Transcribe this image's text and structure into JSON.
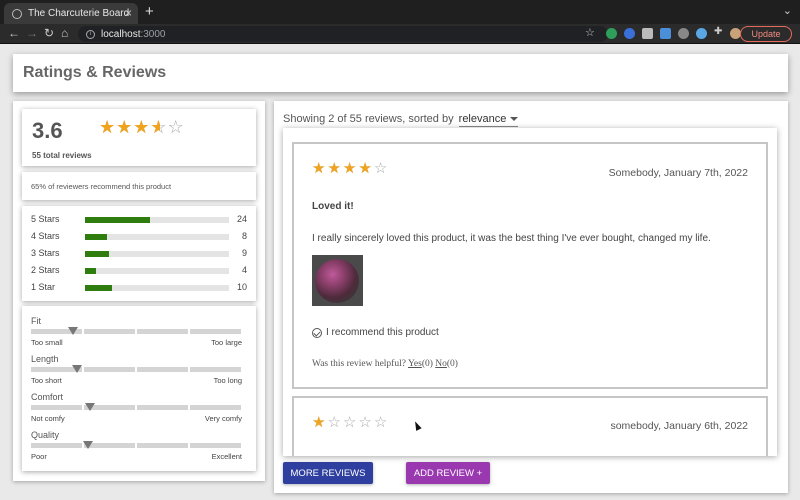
{
  "browser": {
    "tab_title": "The Charcuterie Board",
    "url_host": "localhost",
    "url_port": ":3000",
    "update_label": "Update"
  },
  "page": {
    "title": "Ratings & Reviews"
  },
  "summary": {
    "average": "3.6",
    "average_value": 3.6,
    "total_reviews": "55 total reviews",
    "recommend_text": "65% of reviewers recommend this product"
  },
  "breakdown": [
    {
      "label": "5 Stars",
      "count": "24",
      "value": 24
    },
    {
      "label": "4 Stars",
      "count": "8",
      "value": 8
    },
    {
      "label": "3 Stars",
      "count": "9",
      "value": 9
    },
    {
      "label": "2 Stars",
      "count": "4",
      "value": 4
    },
    {
      "label": "1 Star",
      "count": "10",
      "value": 10
    }
  ],
  "characteristics": [
    {
      "name": "Fit",
      "low": "Too small",
      "high": "Too large",
      "level": 0.2
    },
    {
      "name": "Length",
      "low": "Too short",
      "high": "Too long",
      "level": 0.22
    },
    {
      "name": "Comfort",
      "low": "Not comfy",
      "high": "Very comfy",
      "level": 0.28
    },
    {
      "name": "Quality",
      "low": "Poor",
      "high": "Excellent",
      "level": 0.27
    }
  ],
  "list": {
    "showing_text": "Showing 2 of 55 reviews, sorted by",
    "sort_value": "relevance"
  },
  "reviews": [
    {
      "rating": 4,
      "author_date": "Somebody, January 7th, 2022",
      "summary": "Loved it!",
      "body": "I really sincerely loved this product, it was the best thing I've ever bought, changed my life.",
      "recommend": "I recommend this product",
      "helpful_prefix": "Was this review helpful?",
      "yes_label": "Yes",
      "yes_count": "(0)",
      "no_label": "No",
      "no_count": "(0)"
    },
    {
      "rating": 1,
      "author_date": "somebody, January 6th, 2022"
    }
  ],
  "buttons": {
    "more_reviews": "MORE REVIEWS",
    "add_review": "ADD REVIEW +"
  },
  "colors": {
    "star": "#f0a31f",
    "bar_fill": "#2e7d0e",
    "more_button": "#2f3f9f",
    "add_button": "#9a38b0"
  }
}
